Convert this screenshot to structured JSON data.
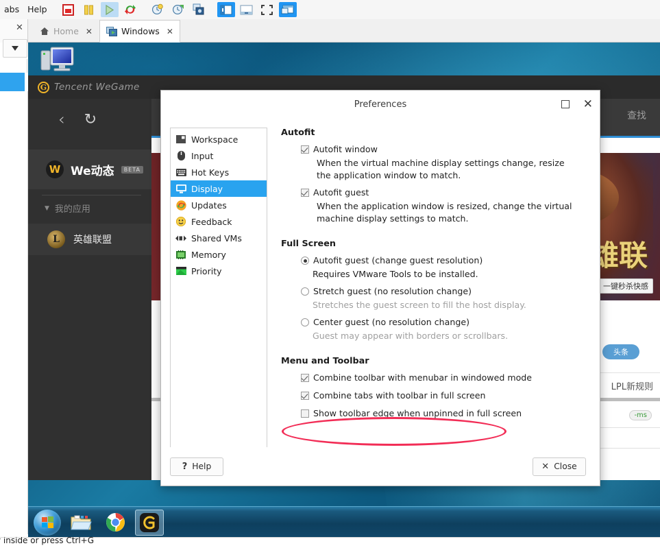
{
  "host": {
    "menu": [
      {
        "label": "abs",
        "name": "menu-tabs"
      },
      {
        "label": "Help",
        "name": "menu-help"
      }
    ],
    "toolbar_icons": [
      {
        "name": "power-off-icon",
        "state": "normal"
      },
      {
        "name": "pause-icon",
        "state": "normal"
      },
      {
        "name": "play-icon",
        "state": "selected-light"
      },
      {
        "name": "restart-icon",
        "state": "normal"
      },
      {
        "name": "snapshot-take-icon",
        "state": "normal"
      },
      {
        "name": "snapshot-revert-icon",
        "state": "normal"
      },
      {
        "name": "snapshot-manager-icon",
        "state": "normal"
      },
      {
        "name": "show-library-icon",
        "state": "selected"
      },
      {
        "name": "show-thumbnails-icon",
        "state": "normal"
      },
      {
        "name": "fullscreen-icon",
        "state": "normal"
      },
      {
        "name": "unity-mode-icon",
        "state": "selected"
      }
    ],
    "tabs": [
      {
        "label": "Home",
        "icon": "home-icon",
        "active": false
      },
      {
        "label": "Windows",
        "icon": "vm-icon",
        "active": true
      }
    ],
    "status_text": "y inside or press Ctrl+G"
  },
  "vm": {
    "wegame": {
      "brand": "Tencent WeGame",
      "brand_logo": "G",
      "nav": {
        "back": "‹",
        "reload": "↻"
      },
      "dynamic": {
        "icon_letter": "W",
        "title": "We动态",
        "badge": "BETA"
      },
      "my_apps_label": "我的应用",
      "app_item": {
        "icon_letter": "L",
        "label": "英雄联盟"
      },
      "search_label": "查找",
      "banner_text": "英雄联",
      "banner_tip": "一键秒杀快感",
      "tag": "头条",
      "news": "LPL新规则",
      "latency": "-ms"
    },
    "taskbar": [
      {
        "name": "start-button",
        "icon": "windows-logo-icon"
      },
      {
        "name": "taskbar-explorer",
        "icon": "folder-icon"
      },
      {
        "name": "taskbar-chrome",
        "icon": "chrome-icon"
      },
      {
        "name": "taskbar-wegame",
        "icon": "wegame-icon",
        "active": true
      }
    ]
  },
  "dialog": {
    "title": "Preferences",
    "window_buttons": {
      "maximize": "maximize-icon",
      "close": "✕"
    },
    "sidebar": [
      {
        "label": "Workspace",
        "icon": "workspace-icon",
        "active": false
      },
      {
        "label": "Input",
        "icon": "mouse-icon",
        "active": false
      },
      {
        "label": "Hot Keys",
        "icon": "keyboard-icon",
        "active": false
      },
      {
        "label": "Display",
        "icon": "display-icon",
        "active": true
      },
      {
        "label": "Updates",
        "icon": "updates-icon",
        "active": false
      },
      {
        "label": "Feedback",
        "icon": "feedback-icon",
        "active": false
      },
      {
        "label": "Shared VMs",
        "icon": "shared-vms-icon",
        "active": false
      },
      {
        "label": "Memory",
        "icon": "memory-icon",
        "active": false
      },
      {
        "label": "Priority",
        "icon": "priority-icon",
        "active": false
      }
    ],
    "groups": {
      "autofit": {
        "title": "Autofit",
        "window_label": "Autofit window",
        "window_checked": true,
        "window_desc": "When the virtual machine display settings change, resize the application window to match.",
        "guest_label": "Autofit guest",
        "guest_checked": true,
        "guest_desc": "When the application window is resized, change the virtual machine display settings to match."
      },
      "fullscreen": {
        "title": "Full Screen",
        "options": [
          {
            "label": "Autofit guest (change guest resolution)",
            "selected": true,
            "desc": "Requires VMware Tools to be installed.",
            "desc_dim": false
          },
          {
            "label": "Stretch guest (no resolution change)",
            "selected": false,
            "desc": "Stretches the guest screen to fill the host display.",
            "desc_dim": true
          },
          {
            "label": "Center guest (no resolution change)",
            "selected": false,
            "desc": "Guest may appear with borders or scrollbars.",
            "desc_dim": true
          }
        ]
      },
      "menu_toolbar": {
        "title": "Menu and Toolbar",
        "options": [
          {
            "label": "Combine toolbar with menubar in windowed mode",
            "checked": true,
            "annotated": false
          },
          {
            "label": "Combine tabs with toolbar in full screen",
            "checked": true,
            "annotated": false
          },
          {
            "label": "Show toolbar edge when unpinned in full screen",
            "checked": false,
            "annotated": true
          }
        ]
      }
    },
    "footer": {
      "help_label": "Help",
      "help_icon": "?",
      "close_label": "Close",
      "close_icon": "✕"
    }
  },
  "colors": {
    "accent_blue": "#29a3ef",
    "annotation_red": "#f22d56",
    "toolbar_selected": "#2196f3",
    "dialog_bg": "#ffffff"
  }
}
